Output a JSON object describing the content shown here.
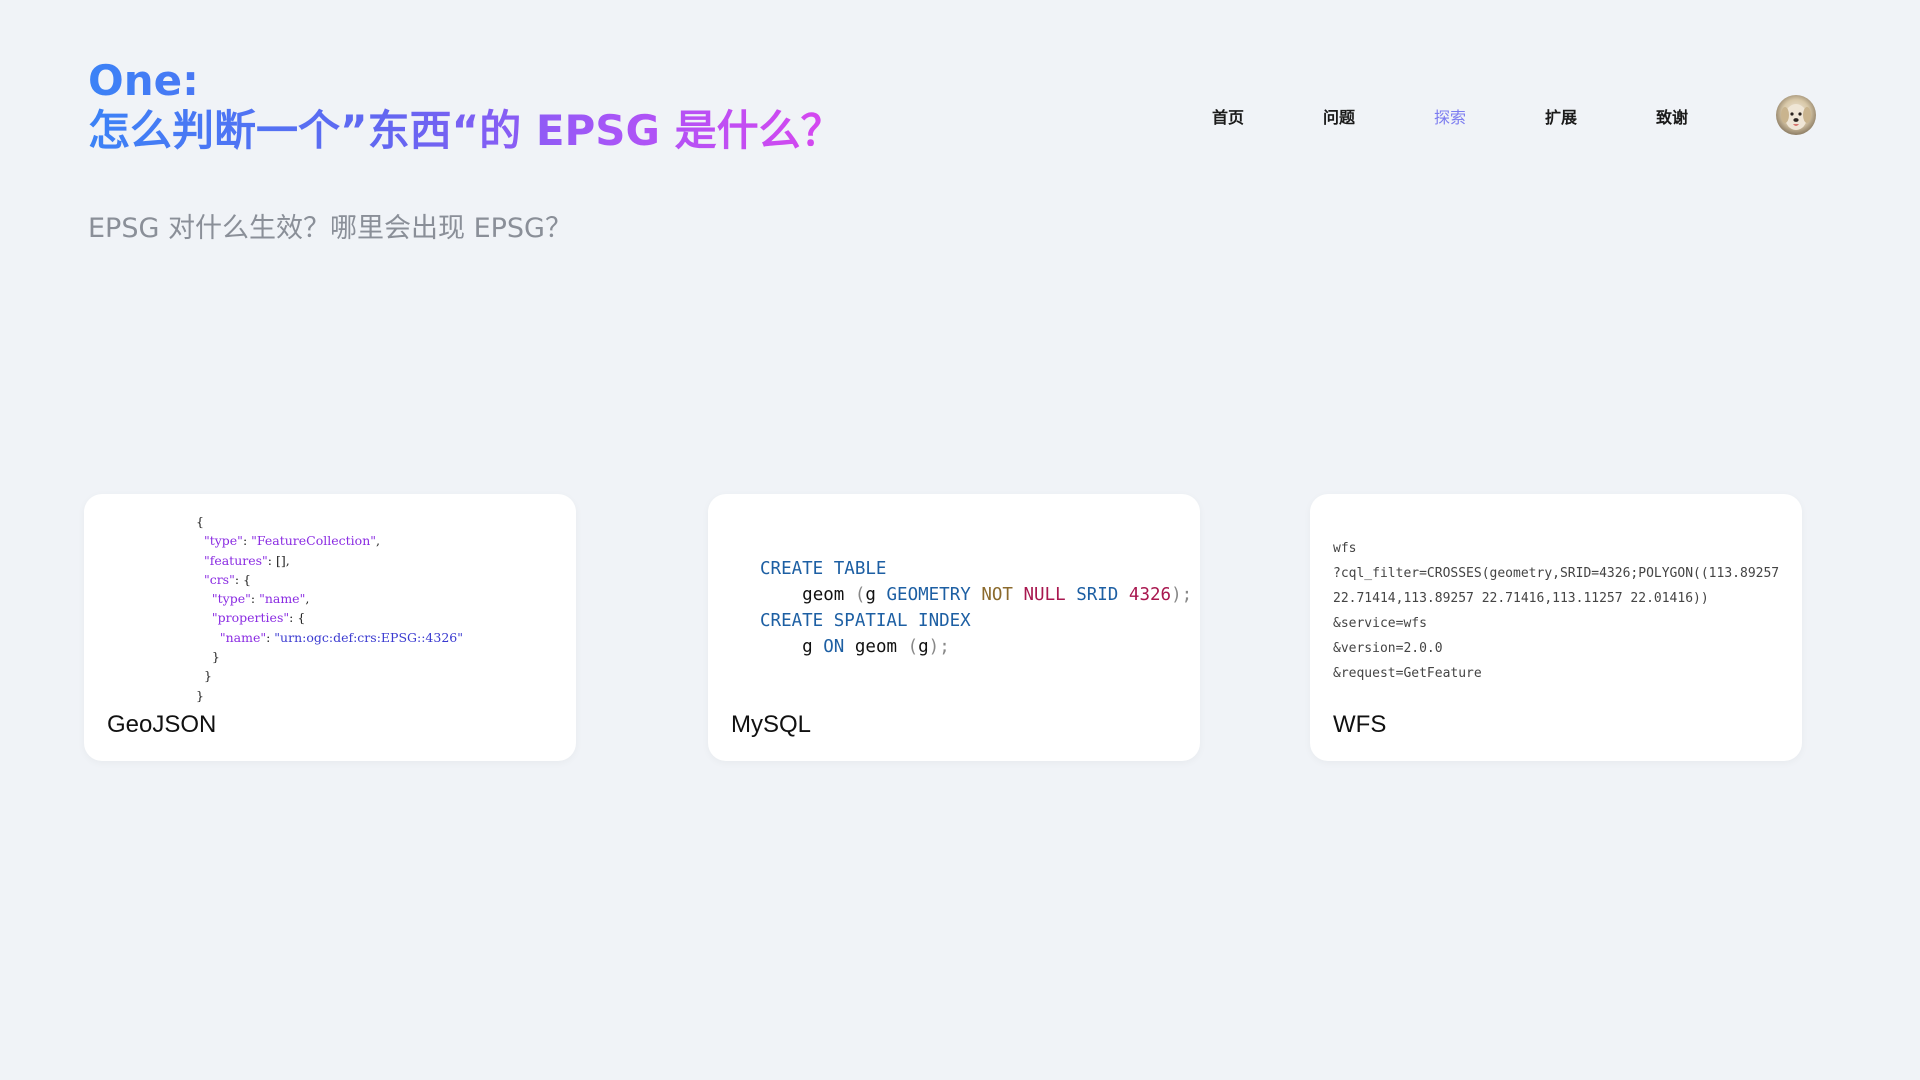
{
  "heading": {
    "line1": "One:",
    "line2": "怎么判断一个”东西“的 EPSG 是什么？"
  },
  "subtitle": "EPSG 对什么生效？哪里会出现 EPSG？",
  "nav": {
    "items": [
      {
        "label": "首页",
        "active": false
      },
      {
        "label": "问题",
        "active": false
      },
      {
        "label": "探索",
        "active": true
      },
      {
        "label": "扩展",
        "active": false
      },
      {
        "label": "致谢",
        "active": false
      }
    ]
  },
  "colors": {
    "background": "#f0f3f7",
    "gradient_start": "#3b82f6",
    "gradient_end": "#d946ef",
    "nav_active": "#7c7cf0",
    "subtitle": "#8a8f98"
  },
  "cards": [
    {
      "label": "GeoJSON",
      "code": {
        "open": "{",
        "type_key": "\"type\"",
        "type_val": "\"FeatureCollection\"",
        "features_key": "\"features\"",
        "features_val": "[],",
        "crs_key": "\"crs\"",
        "crs_open": "{",
        "crs_type_key": "\"type\"",
        "crs_type_val": "\"name\"",
        "properties_key": "\"properties\"",
        "properties_open": "{",
        "name_key": "\"name\"",
        "name_val": "\"urn:ogc:def:crs:EPSG::4326\"",
        "close_inner": "}",
        "close_crs": "}",
        "close": "}"
      }
    },
    {
      "label": "MySQL",
      "code": {
        "create_table": "CREATE TABLE",
        "geom": "geom",
        "paren_open": "(",
        "g": "g",
        "geometry": "GEOMETRY",
        "not": "NOT",
        "null": "NULL",
        "srid": "SRID",
        "srid_val": "4326",
        "stmt_end": ");",
        "create_index": "CREATE SPATIAL INDEX",
        "on": "ON",
        "geom2": "geom",
        "paren2_open": "(",
        "g2": "g",
        "stmt2_end": ");"
      }
    },
    {
      "label": "WFS",
      "code": {
        "lines": [
          "wfs",
          "?cql_filter=CROSSES(geometry,SRID=4326;POLYGON((113.89257",
          "22.71414,113.89257 22.71416,113.11257 22.01416))",
          "&service=wfs",
          "&version=2.0.0",
          "&request=GetFeature"
        ]
      }
    }
  ]
}
